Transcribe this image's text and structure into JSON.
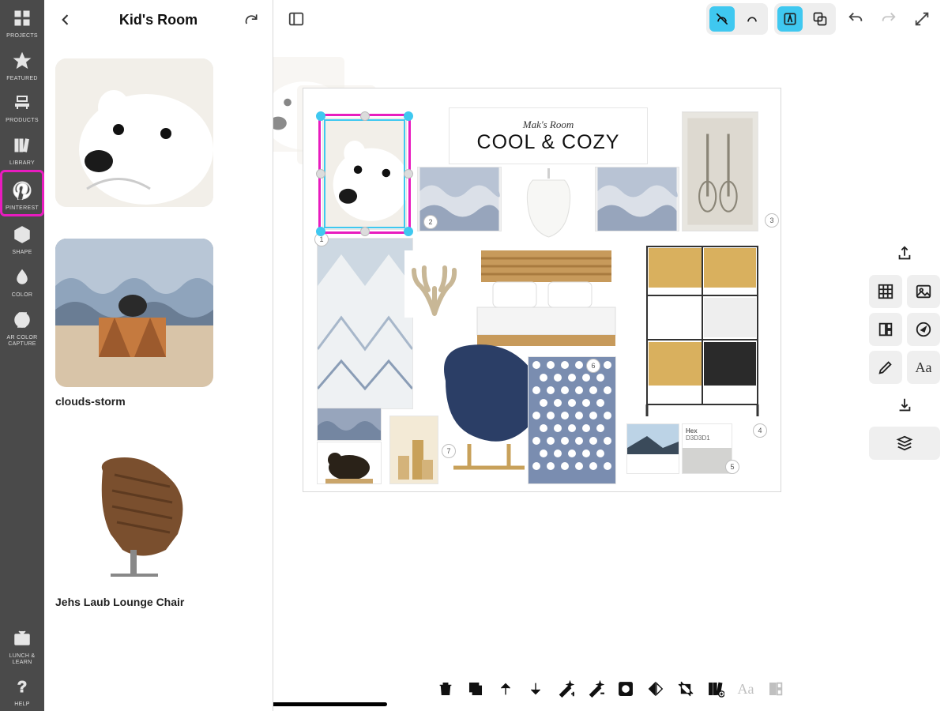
{
  "rail": {
    "items": [
      {
        "name": "projects",
        "label": "PROJECTS",
        "icon": "grid"
      },
      {
        "name": "featured",
        "label": "FEATURED",
        "icon": "star"
      },
      {
        "name": "products",
        "label": "PRODUCTS",
        "icon": "chair"
      },
      {
        "name": "library",
        "label": "LIBRARY",
        "icon": "books"
      },
      {
        "name": "pinterest",
        "label": "PINTEREST",
        "icon": "pinterest",
        "highlight": true
      },
      {
        "name": "shape",
        "label": "SHAPE",
        "icon": "cube"
      },
      {
        "name": "color",
        "label": "COLOR",
        "icon": "drop"
      },
      {
        "name": "arcolor",
        "label": "AR COLOR CAPTURE",
        "icon": "aperture"
      }
    ],
    "footer": [
      {
        "name": "lunchlearn",
        "label": "LUNCH & LEARN",
        "icon": "tv"
      },
      {
        "name": "help",
        "label": "HELP",
        "icon": "question"
      }
    ]
  },
  "panel": {
    "title": "Kid's Room",
    "pins": [
      {
        "label": "",
        "kind": "polar-bear"
      },
      {
        "label": "clouds-storm",
        "kind": "clouds"
      },
      {
        "label": "Jehs Laub Lounge Chair",
        "kind": "lounge-chair"
      }
    ]
  },
  "board": {
    "subtitle": "Mak's Room",
    "title": "COOL & COZY",
    "numbers": [
      "1",
      "2",
      "3",
      "4",
      "5",
      "6",
      "7"
    ],
    "hex_label": "Hex",
    "hex_value": "D3D3D1"
  },
  "props": {
    "aa": "Aa"
  },
  "context_bar": {
    "aa": "Aa"
  }
}
